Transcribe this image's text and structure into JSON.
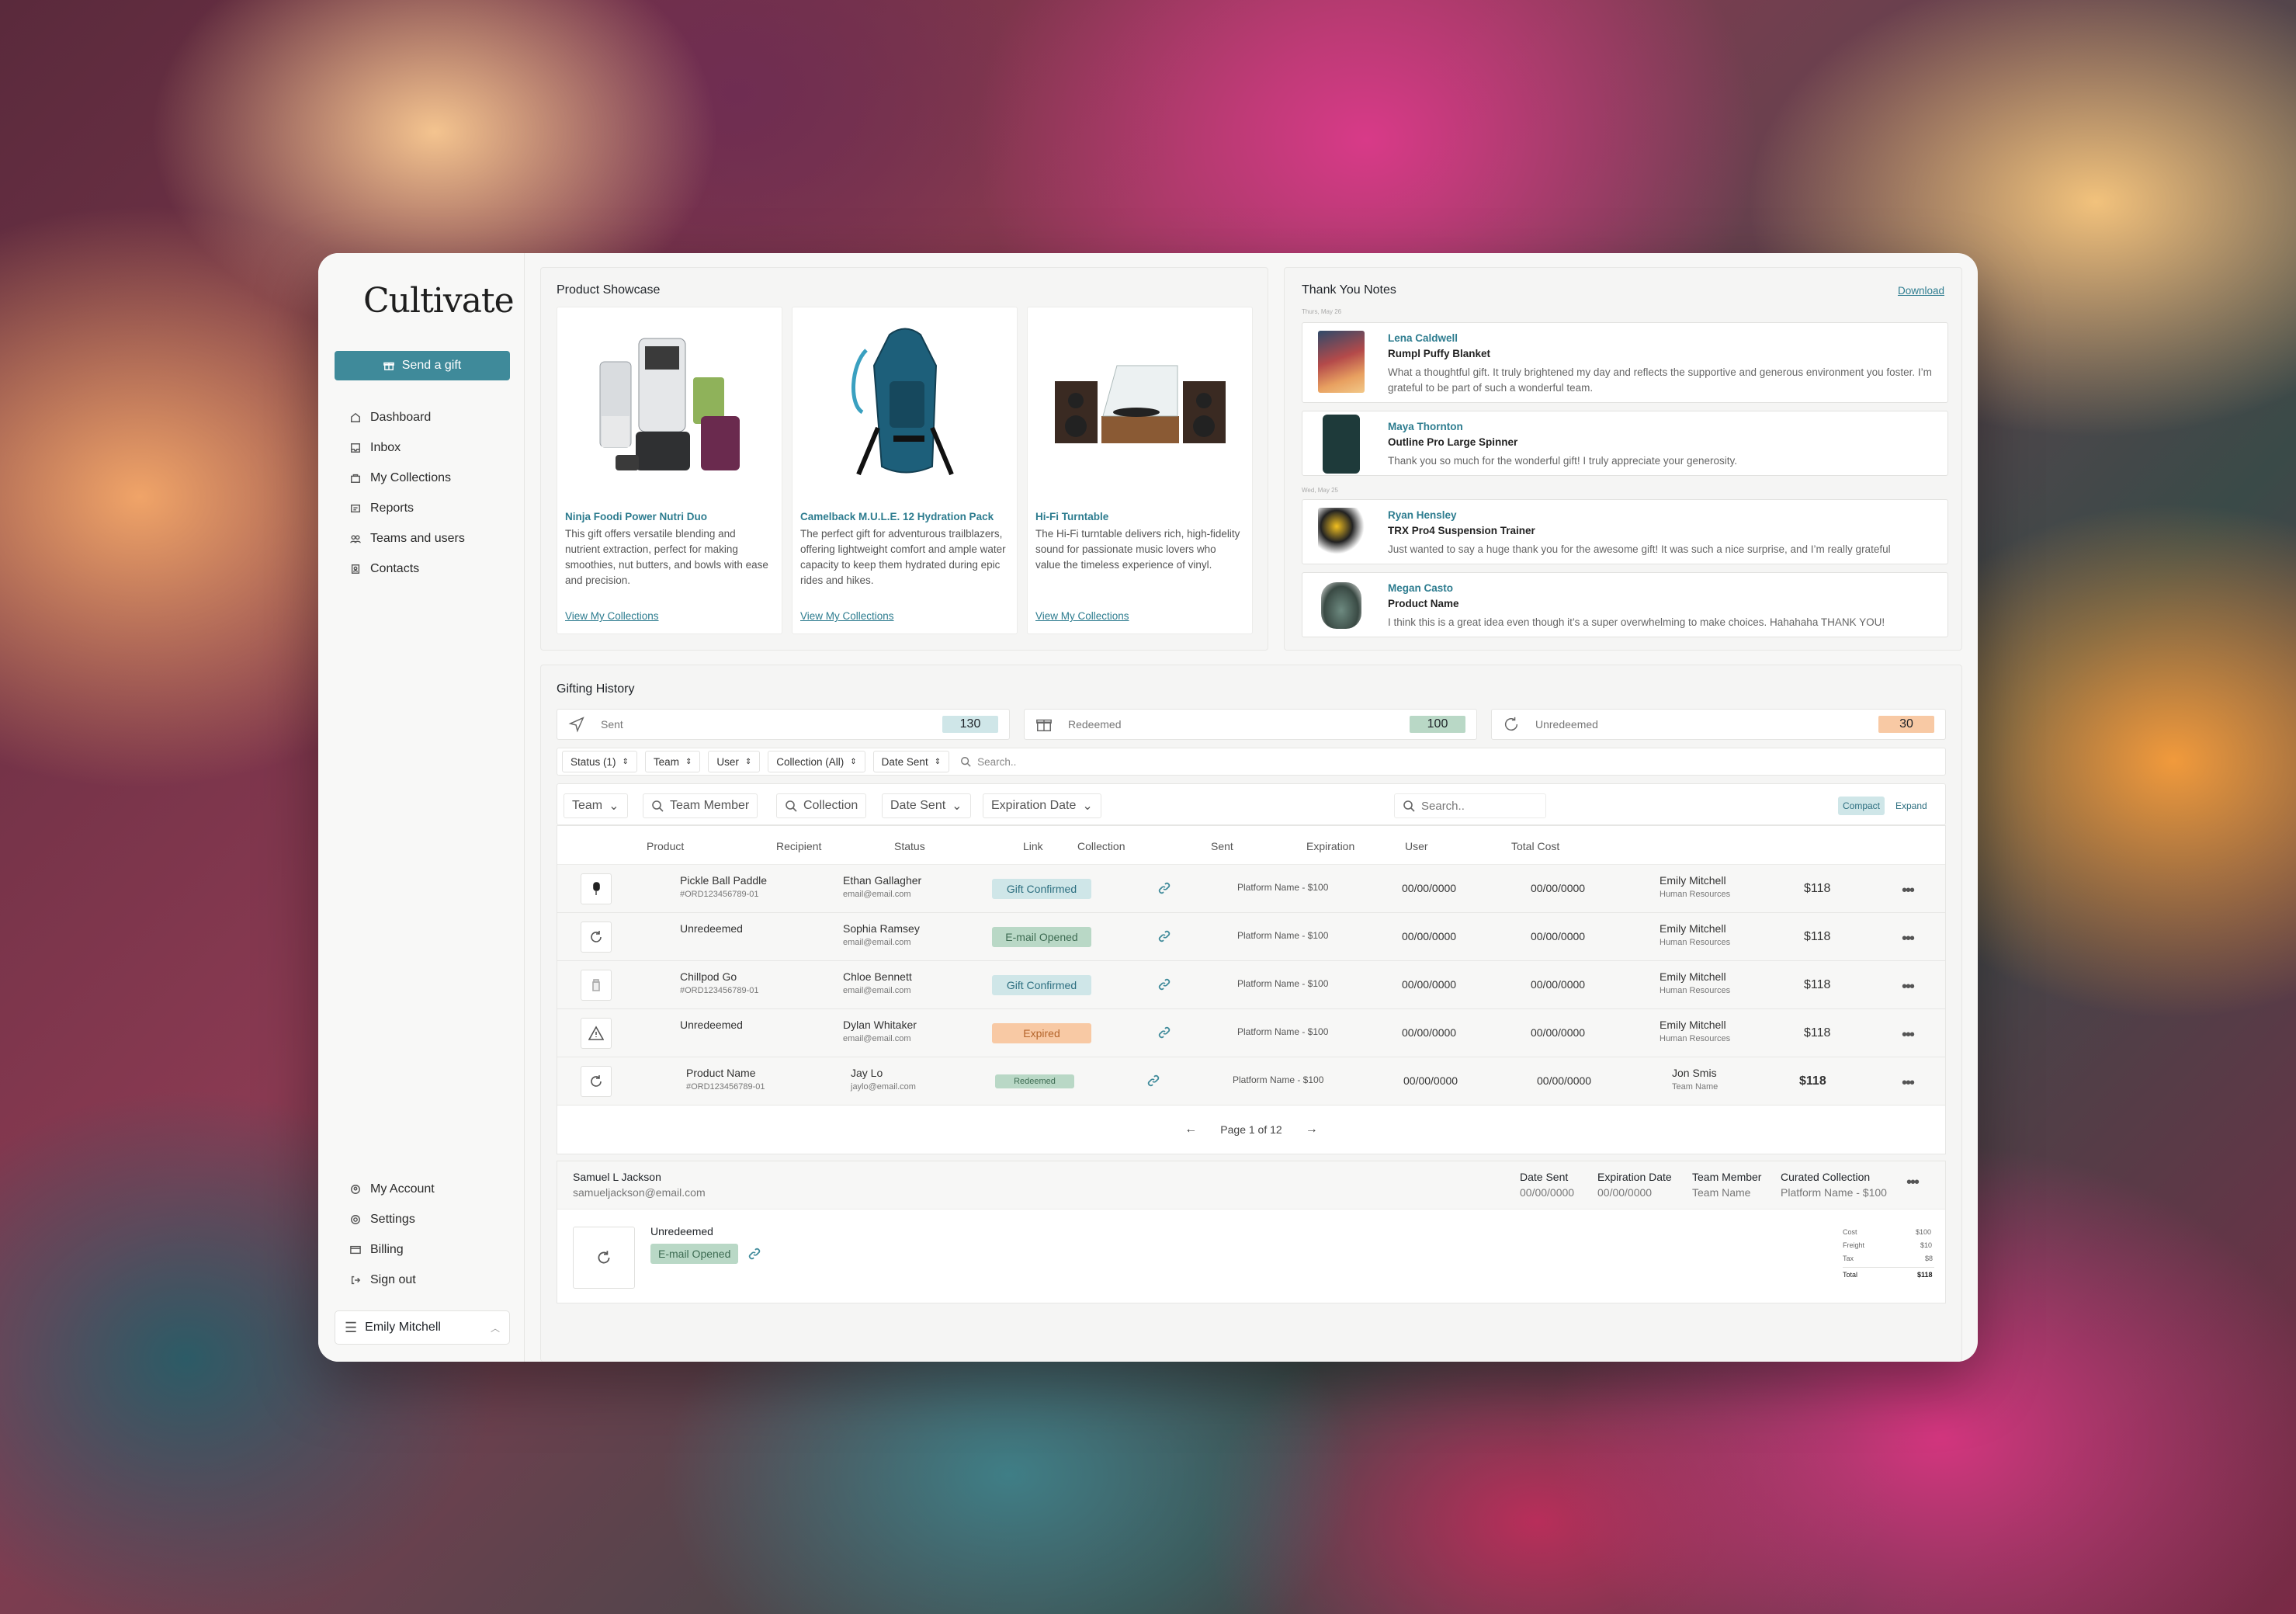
{
  "app": {
    "logo": "Cultivate",
    "send_gift": "Send a gift"
  },
  "nav": [
    {
      "label": "Dashboard",
      "icon": "home-icon"
    },
    {
      "label": "Inbox",
      "icon": "inbox-icon"
    },
    {
      "label": "My Collections",
      "icon": "bag-icon"
    },
    {
      "label": "Reports",
      "icon": "report-icon"
    },
    {
      "label": "Teams and users",
      "icon": "users-icon"
    },
    {
      "label": "Contacts",
      "icon": "contacts-icon"
    }
  ],
  "nav_bottom": [
    {
      "label": "My Account",
      "icon": "account-icon"
    },
    {
      "label": "Settings",
      "icon": "gear-icon"
    },
    {
      "label": "Billing",
      "icon": "card-icon"
    },
    {
      "label": "Sign out",
      "icon": "signout-icon"
    }
  ],
  "current_user": "Emily Mitchell",
  "showcase": {
    "title": "Product Showcase",
    "items": [
      {
        "title": "Ninja Foodi Power Nutri Duo",
        "desc": "This gift offers versatile blending and nutrient extraction, perfect for making smoothies, nut butters, and bowls with ease and precision.",
        "link": "View My Collections"
      },
      {
        "title": "Camelback M.U.L.E. 12 Hydration Pack",
        "desc": "The perfect gift for adventurous trailblazers, offering lightweight comfort and ample water capacity to keep them hydrated during epic rides and hikes.",
        "link": "View My Collections"
      },
      {
        "title": "Hi-Fi Turntable",
        "desc": "The Hi-Fi turntable delivers rich, high-fidelity sound for passionate music lovers who value the timeless experience of vinyl.",
        "link": "View My Collections"
      }
    ]
  },
  "notes": {
    "title": "Thank You Notes",
    "download": "Download",
    "day1": "Thurs, May 26",
    "day2": "Wed, May 25",
    "items": [
      {
        "name": "Lena Caldwell",
        "product": "Rumpl Puffy Blanket",
        "text": "What a thoughtful gift. It truly brightened my day and reflects the supportive and generous environment you foster. I’m grateful to be part of such a wonderful team."
      },
      {
        "name": "Maya Thornton",
        "product": "Outline Pro Large Spinner",
        "text": "Thank you so much for the wonderful gift! I truly appreciate your generosity."
      },
      {
        "name": "Ryan Hensley",
        "product": "TRX Pro4 Suspension Trainer",
        "text": "Just wanted to say a huge thank you for the awesome gift! It was such a nice surprise, and I’m really grateful"
      },
      {
        "name": "Megan Casto",
        "product": "Product Name",
        "text": "I think this is a great idea even though it’s a super overwhelming to make choices. Hahahaha THANK YOU!"
      }
    ]
  },
  "history": {
    "title": "Gifting History",
    "stats": [
      {
        "label": "Sent",
        "count": "130",
        "color": "#cfe6e8"
      },
      {
        "label": "Redeemed",
        "count": "100",
        "color": "#b9d8c6"
      },
      {
        "label": "Unredeemed",
        "count": "30",
        "color": "#f8c9a4"
      }
    ],
    "filters": [
      "Status (1)",
      "Team",
      "User",
      "Collection (All)",
      "Date Sent"
    ],
    "search_placeholder": "Search..",
    "filters2": [
      "Team",
      "Team Member",
      "Collection",
      "Date Sent",
      "Expiration Date"
    ],
    "search2_placeholder": "Search..",
    "view_compact": "Compact",
    "view_expand": "Expand",
    "columns": [
      "Product",
      "Recipient",
      "Status",
      "Link",
      "Collection",
      "Sent",
      "Expiration",
      "User",
      "Total Cost"
    ],
    "rows": [
      {
        "product": "Pickle Ball Paddle",
        "order": "#ORD123456789-01",
        "recipient": "Ethan Gallagher",
        "email": "email@email.com",
        "status": "Gift Confirmed",
        "collection": "Platform Name - $100",
        "sent": "00/00/0000",
        "expiration": "00/00/0000",
        "user": "Emily Mitchell",
        "team": "Human Resources",
        "cost": "$118"
      },
      {
        "product": "Unredeemed",
        "order": "",
        "recipient": "Sophia Ramsey",
        "email": "email@email.com",
        "status": "E-mail Opened",
        "collection": "Platform Name - $100",
        "sent": "00/00/0000",
        "expiration": "00/00/0000",
        "user": "Emily Mitchell",
        "team": "Human Resources",
        "cost": "$118"
      },
      {
        "product": "Chillpod Go",
        "order": "#ORD123456789-01",
        "recipient": "Chloe Bennett",
        "email": "email@email.com",
        "status": "Gift Confirmed",
        "collection": "Platform Name - $100",
        "sent": "00/00/0000",
        "expiration": "00/00/0000",
        "user": "Emily Mitchell",
        "team": "Human Resources",
        "cost": "$118"
      },
      {
        "product": "Unredeemed",
        "order": "",
        "recipient": "Dylan Whitaker",
        "email": "email@email.com",
        "status": "Expired",
        "collection": "Platform Name - $100",
        "sent": "00/00/0000",
        "expiration": "00/00/0000",
        "user": "Emily Mitchell",
        "team": "Human Resources",
        "cost": "$118"
      },
      {
        "product": "Product Name",
        "order": "#ORD123456789-01",
        "recipient": "Jay Lo",
        "email": "jaylo@email.com",
        "status": "Redeemed",
        "collection": "Platform Name - $100",
        "sent": "00/00/0000",
        "expiration": "00/00/0000",
        "user": "Jon Smis",
        "team": "Team Name",
        "cost": "$118"
      }
    ],
    "pager": "Page 1 of 12"
  },
  "detail": {
    "name": "Samuel L Jackson",
    "email": "samueljackson@email.com",
    "date_sent_label": "Date Sent",
    "date_sent": "00/00/0000",
    "expiration_label": "Expiration Date",
    "expiration": "00/00/0000",
    "member_label": "Team Member",
    "member": "Team Name",
    "collection_label": "Curated Collection",
    "collection": "Platform Name - $100",
    "state": "Unredeemed",
    "status": "E-mail Opened",
    "costs": [
      {
        "label": "Cost",
        "value": "$100"
      },
      {
        "label": "Freight",
        "value": "$10"
      },
      {
        "label": "Tax",
        "value": "$8"
      },
      {
        "label": "Total",
        "value": "$118"
      }
    ]
  },
  "colors": {
    "accent": "#3f8a9a",
    "link": "#2d7c8f",
    "confirmed": "#cfe6e8",
    "opened": "#b9d8c6",
    "expired": "#f8c9a4"
  }
}
